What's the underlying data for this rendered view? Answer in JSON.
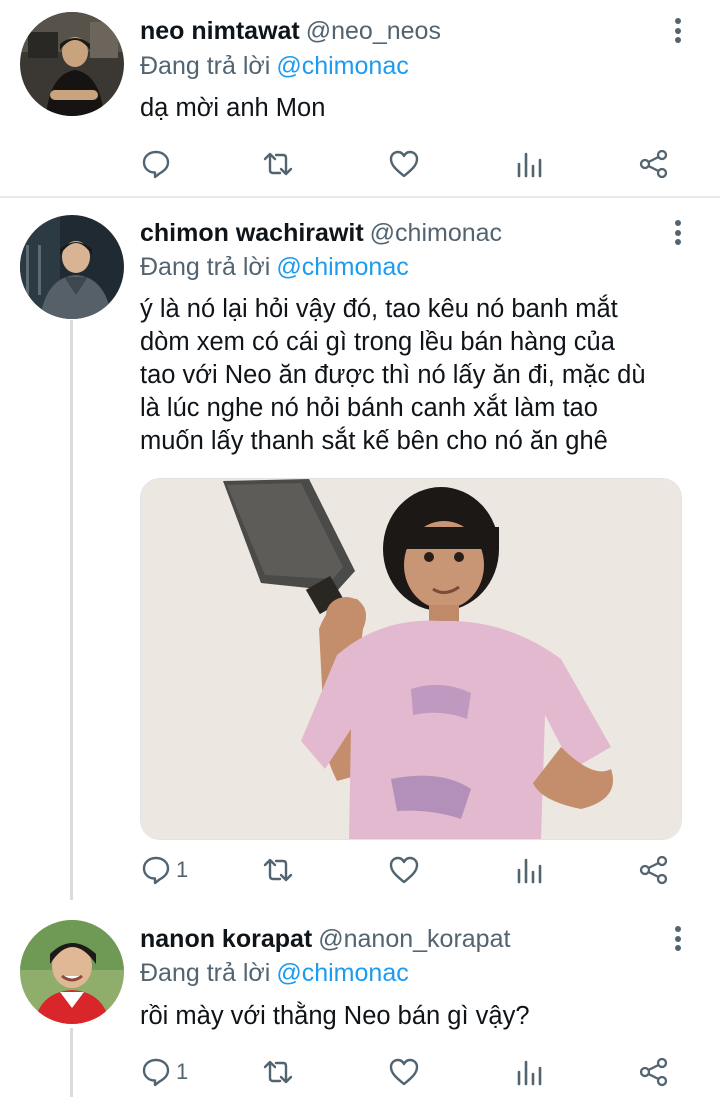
{
  "tweets": [
    {
      "display_name": "neo nimtawat",
      "handle": "@neo_neos",
      "replying_label": "Đang trả lời",
      "replying_to": "@chimonac",
      "text_lines": [
        "dạ mời anh Mon"
      ],
      "reply_count": "",
      "avatar_icon": "person-avatar-dark-room"
    },
    {
      "display_name": "chimon wachirawit",
      "handle": "@chimonac",
      "replying_label": "Đang trả lời",
      "replying_to": "@chimonac",
      "text_lines": [
        "ý là nó lại hỏi vậy đó, tao kêu nó banh mắt",
        "dòm xem có cái gì trong lều bán hàng của",
        "tao với Neo ăn được thì nó lấy ăn đi, mặc dù",
        "là lúc nghe nó hỏi bánh canh xắt làm tao",
        "muốn lấy thanh sắt kế bên cho nó ăn ghê"
      ],
      "reply_count": "1",
      "avatar_icon": "person-avatar-hood",
      "media": "photo of person in pink t-shirt holding a cleaver"
    },
    {
      "display_name": "nanon korapat",
      "handle": "@nanon_korapat",
      "replying_label": "Đang trả lời",
      "replying_to": "@chimonac",
      "text_lines": [
        "rồi mày với thằng Neo bán gì vậy?"
      ],
      "reply_count": "1",
      "avatar_icon": "person-avatar-smiling"
    }
  ],
  "action_icons": [
    "reply-icon",
    "retweet-icon",
    "like-icon",
    "analytics-icon",
    "share-icon"
  ],
  "colors": {
    "text": "#0f1419",
    "secondary": "#536471",
    "mention": "#1d9bf0",
    "divider": "#e7e9eb"
  }
}
